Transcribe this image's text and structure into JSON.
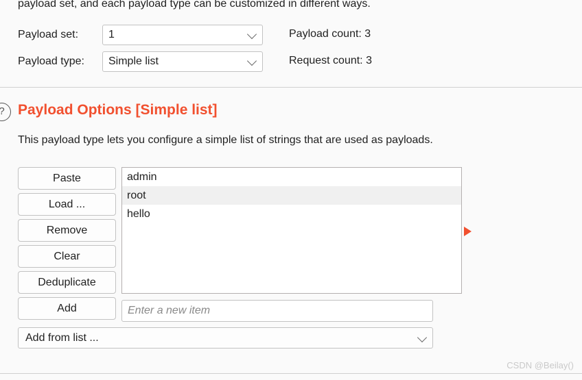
{
  "intro": {
    "text": "payload set, and each payload type can be customized in different ways."
  },
  "payload_config": {
    "set_label": "Payload set:",
    "set_value": "1",
    "type_label": "Payload type:",
    "type_value": "Simple list",
    "payload_count": "Payload count: 3",
    "request_count": "Request count: 3"
  },
  "options_section": {
    "help_icon": "?",
    "title": "Payload Options [Simple list]",
    "description": "This payload type lets you configure a simple list of strings that are used as payloads.",
    "accent_color": "#f1502f"
  },
  "buttons": [
    {
      "label": "Paste",
      "name": "paste-button"
    },
    {
      "label": "Load ...",
      "name": "load-button"
    },
    {
      "label": "Remove",
      "name": "remove-button"
    },
    {
      "label": "Clear",
      "name": "clear-button"
    },
    {
      "label": "Deduplicate",
      "name": "deduplicate-button"
    },
    {
      "label": "Add",
      "name": "add-button"
    }
  ],
  "add_from_list": {
    "label": "Add from list ..."
  },
  "payload_list": {
    "items": [
      {
        "value": "admin",
        "selected": false
      },
      {
        "value": "root",
        "selected": true
      },
      {
        "value": "hello",
        "selected": false
      }
    ]
  },
  "new_item": {
    "value": "",
    "placeholder": "Enter a new item"
  },
  "watermark": {
    "text": "CSDN @Beilay()"
  }
}
